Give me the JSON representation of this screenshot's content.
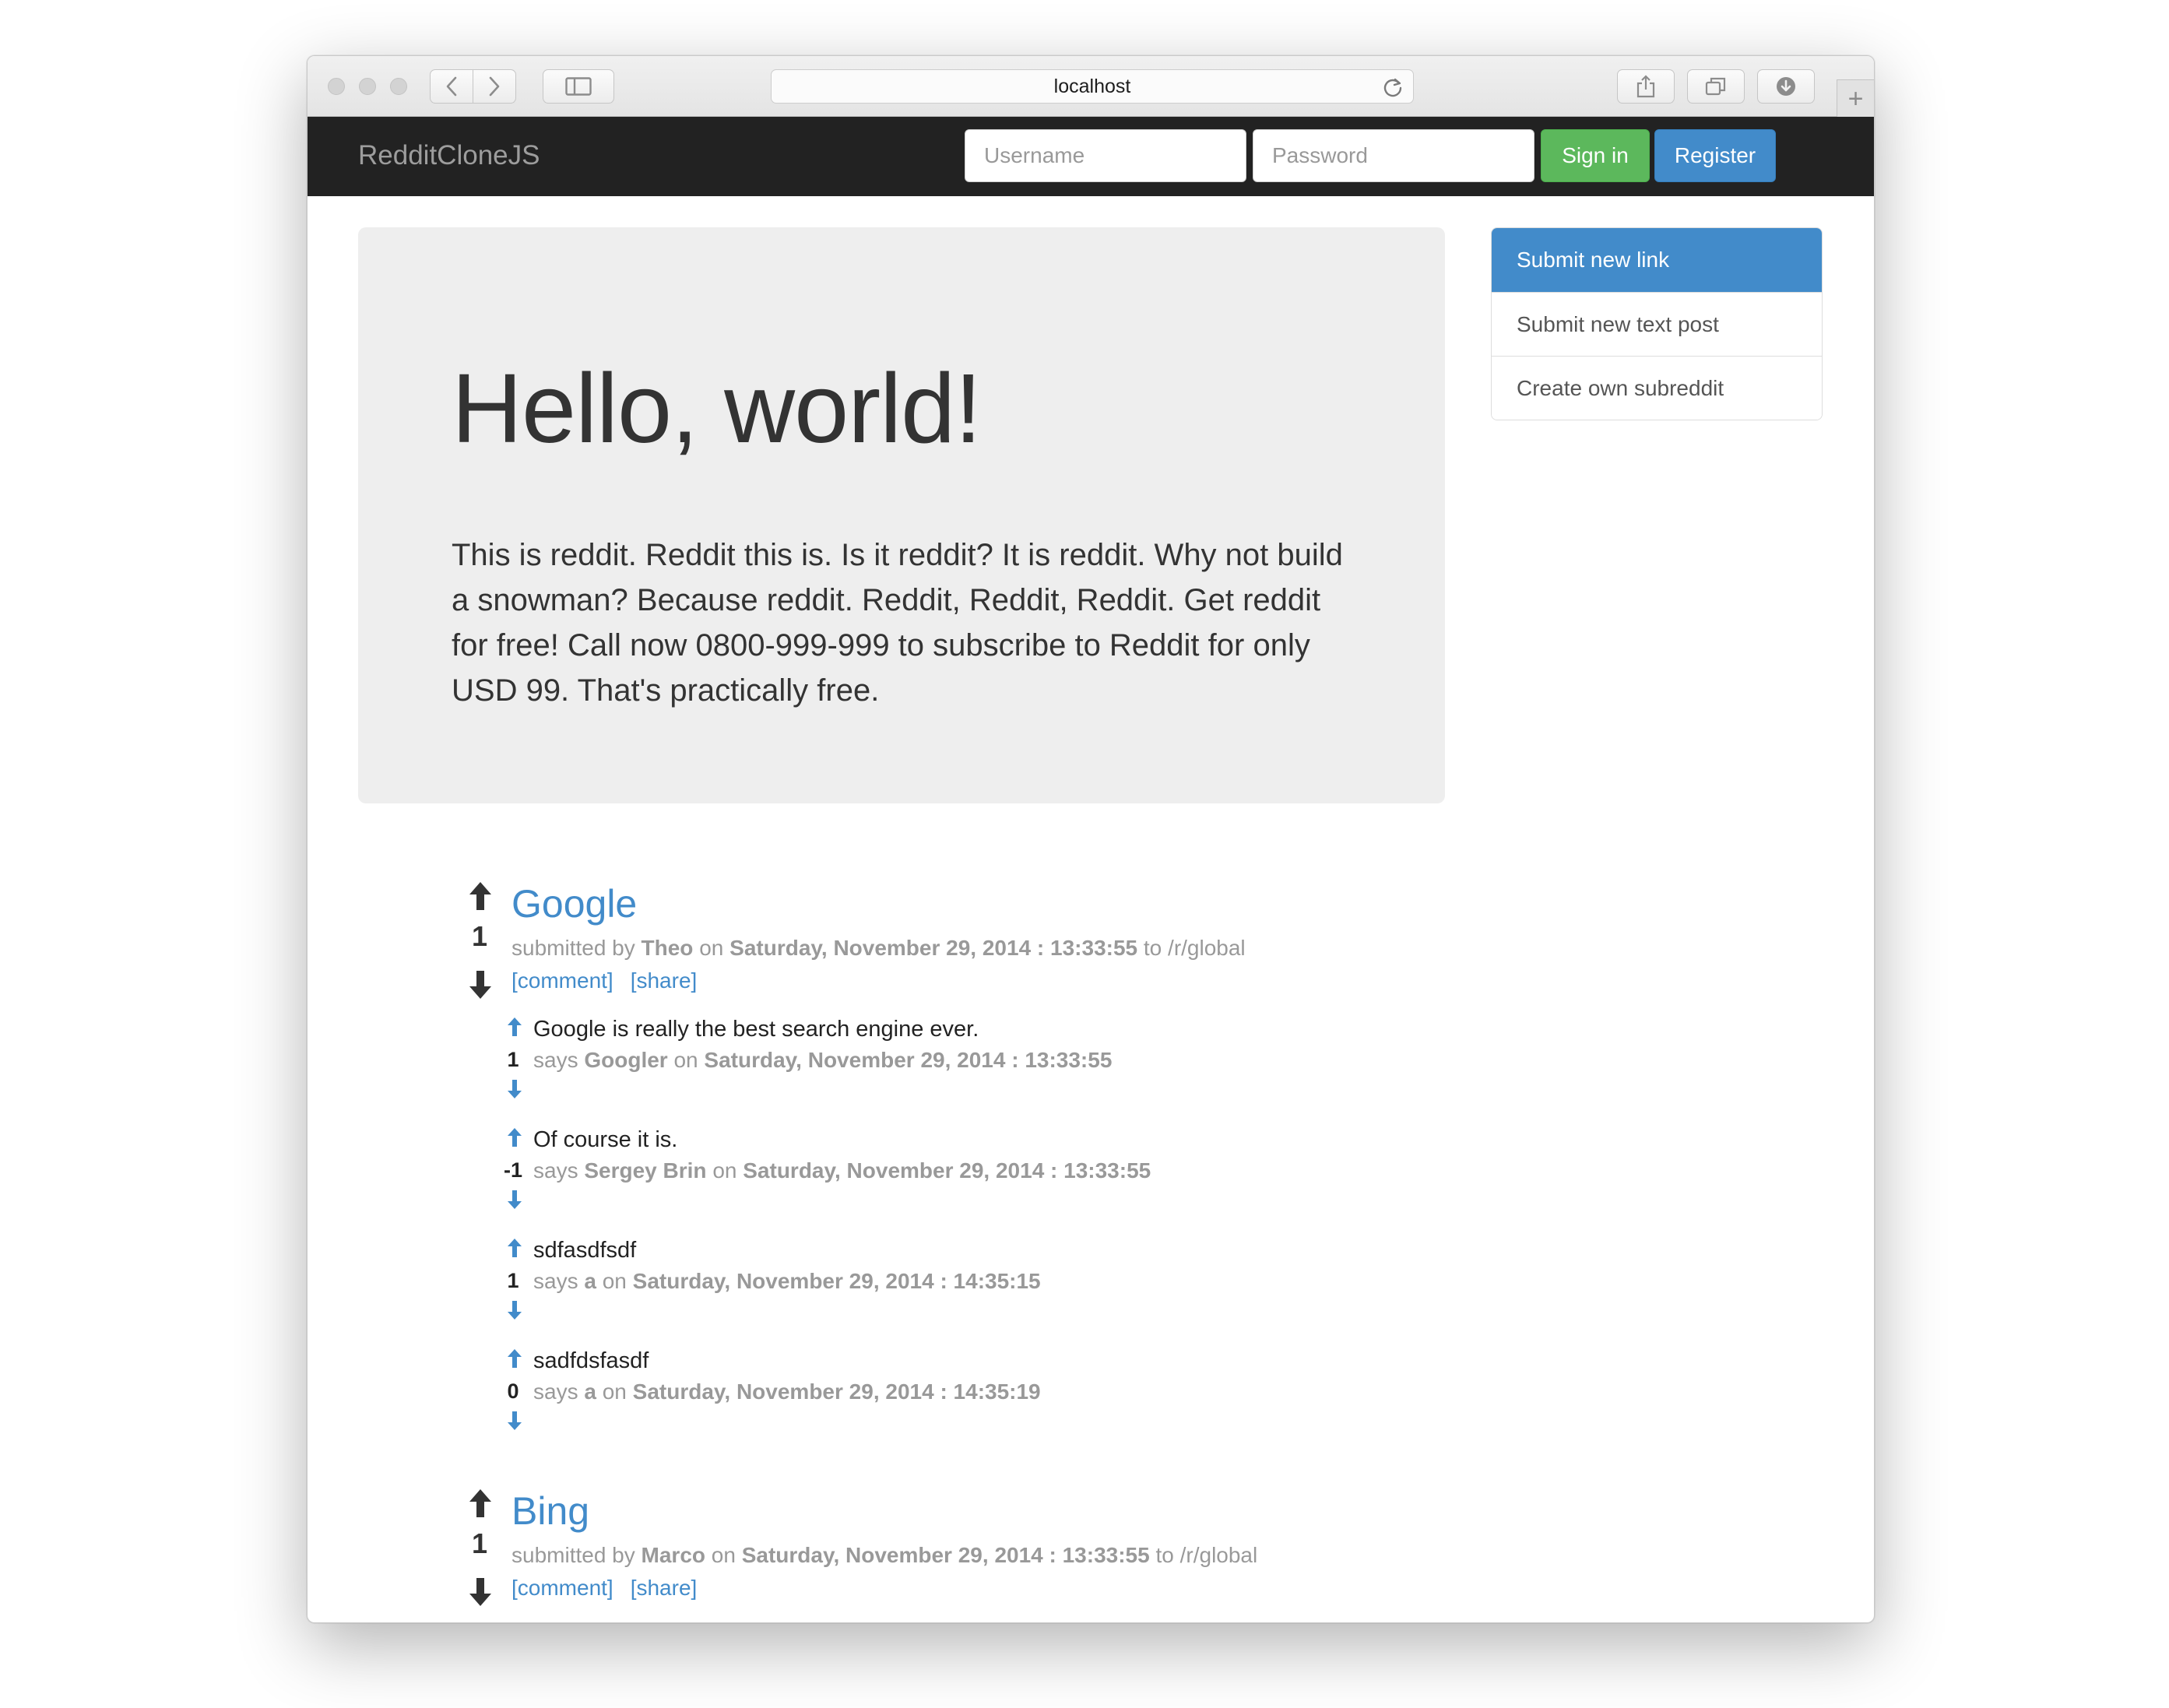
{
  "browser": {
    "address": "localhost"
  },
  "navbar": {
    "brand": "RedditCloneJS",
    "username_placeholder": "Username",
    "password_placeholder": "Password",
    "signin_label": "Sign in",
    "register_label": "Register",
    "colors": {
      "navbar_bg": "#222222",
      "signin_bg": "#5cb85c",
      "register_bg": "#428bca"
    }
  },
  "jumbotron": {
    "title": "Hello, world!",
    "text": "This is reddit. Reddit this is. Is it reddit? It is reddit. Why not build a snowman? Because reddit. Reddit, Reddit, Reddit. Get reddit for free! Call now 0800-999-999 to subscribe to Reddit for only USD 99. That's practically free."
  },
  "sidebar": {
    "items": [
      {
        "label": "Submit new link",
        "active": true
      },
      {
        "label": "Submit new text post",
        "active": false
      },
      {
        "label": "Create own subreddit",
        "active": false
      }
    ]
  },
  "posts": [
    {
      "title": "Google",
      "score": "1",
      "submitted_by": "submitted by",
      "author": "Theo",
      "on": "on",
      "date": "Saturday, November 29, 2014 : 13:33:55",
      "to": "to /r/global",
      "comment_link": "[comment]",
      "share_link": "[share]",
      "comments": [
        {
          "text": "Google is really the best search engine ever.",
          "score": "1",
          "says": "says",
          "author": "Googler",
          "on": "on",
          "date": "Saturday, November 29, 2014 : 13:33:55"
        },
        {
          "text": "Of course it is.",
          "score": "-1",
          "says": "says",
          "author": "Sergey Brin",
          "on": "on",
          "date": "Saturday, November 29, 2014 : 13:33:55"
        },
        {
          "text": "sdfasdfsdf",
          "score": "1",
          "says": "says",
          "author": "a",
          "on": "on",
          "date": "Saturday, November 29, 2014 : 14:35:15"
        },
        {
          "text": "sadfdsfasdf",
          "score": "0",
          "says": "says",
          "author": "a",
          "on": "on",
          "date": "Saturday, November 29, 2014 : 14:35:19"
        }
      ]
    },
    {
      "title": "Bing",
      "score": "1",
      "submitted_by": "submitted by",
      "author": "Marco",
      "on": "on",
      "date": "Saturday, November 29, 2014 : 13:33:55",
      "to": "to /r/global",
      "comment_link": "[comment]",
      "share_link": "[share]"
    }
  ]
}
